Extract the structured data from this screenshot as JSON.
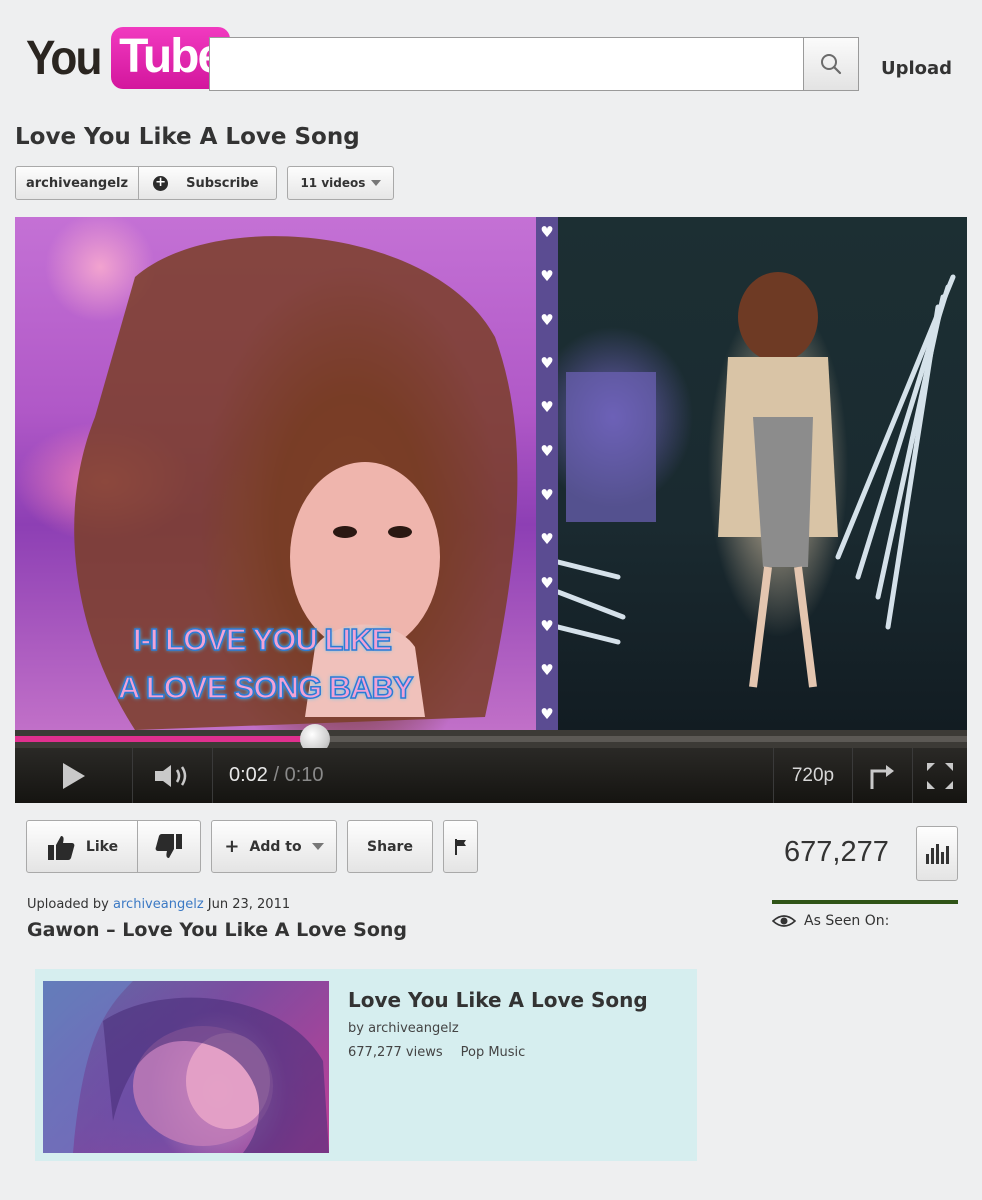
{
  "header": {
    "logo_you": "You",
    "logo_tube": "Tube",
    "search_placeholder": "",
    "upload_label": "Upload"
  },
  "video": {
    "title": "Love You Like A Love Song",
    "channel": "archiveangelz",
    "subscribe_label": "Subscribe",
    "videos_label": "11 videos",
    "lyric_line_1": "I-I LOVE YOU LIKE",
    "lyric_line_2": "A LOVE SONG BABY",
    "current_time": "0:02",
    "duration": "0:10",
    "progress_fraction": 0.2,
    "quality": "720p"
  },
  "actions": {
    "like_label": "Like",
    "add_to_label": "Add to",
    "share_label": "Share"
  },
  "stats": {
    "view_count": "677,277",
    "as_seen_on_label": "As Seen On:",
    "like_color": "#2f5417"
  },
  "description": {
    "uploaded_prefix": "Uploaded by",
    "uploader": "archiveangelz",
    "date": "Jun 23, 2011",
    "title": "Gawon – Love You Like A Love Song"
  },
  "related": {
    "title": "Love You Like A Love Song",
    "by": "by archiveangelz",
    "views": "677,277 views",
    "category": "Pop Music"
  },
  "colors": {
    "brand_pink": "#e0308f",
    "link_blue": "#3b79c4",
    "related_bg": "#d6eeef"
  }
}
